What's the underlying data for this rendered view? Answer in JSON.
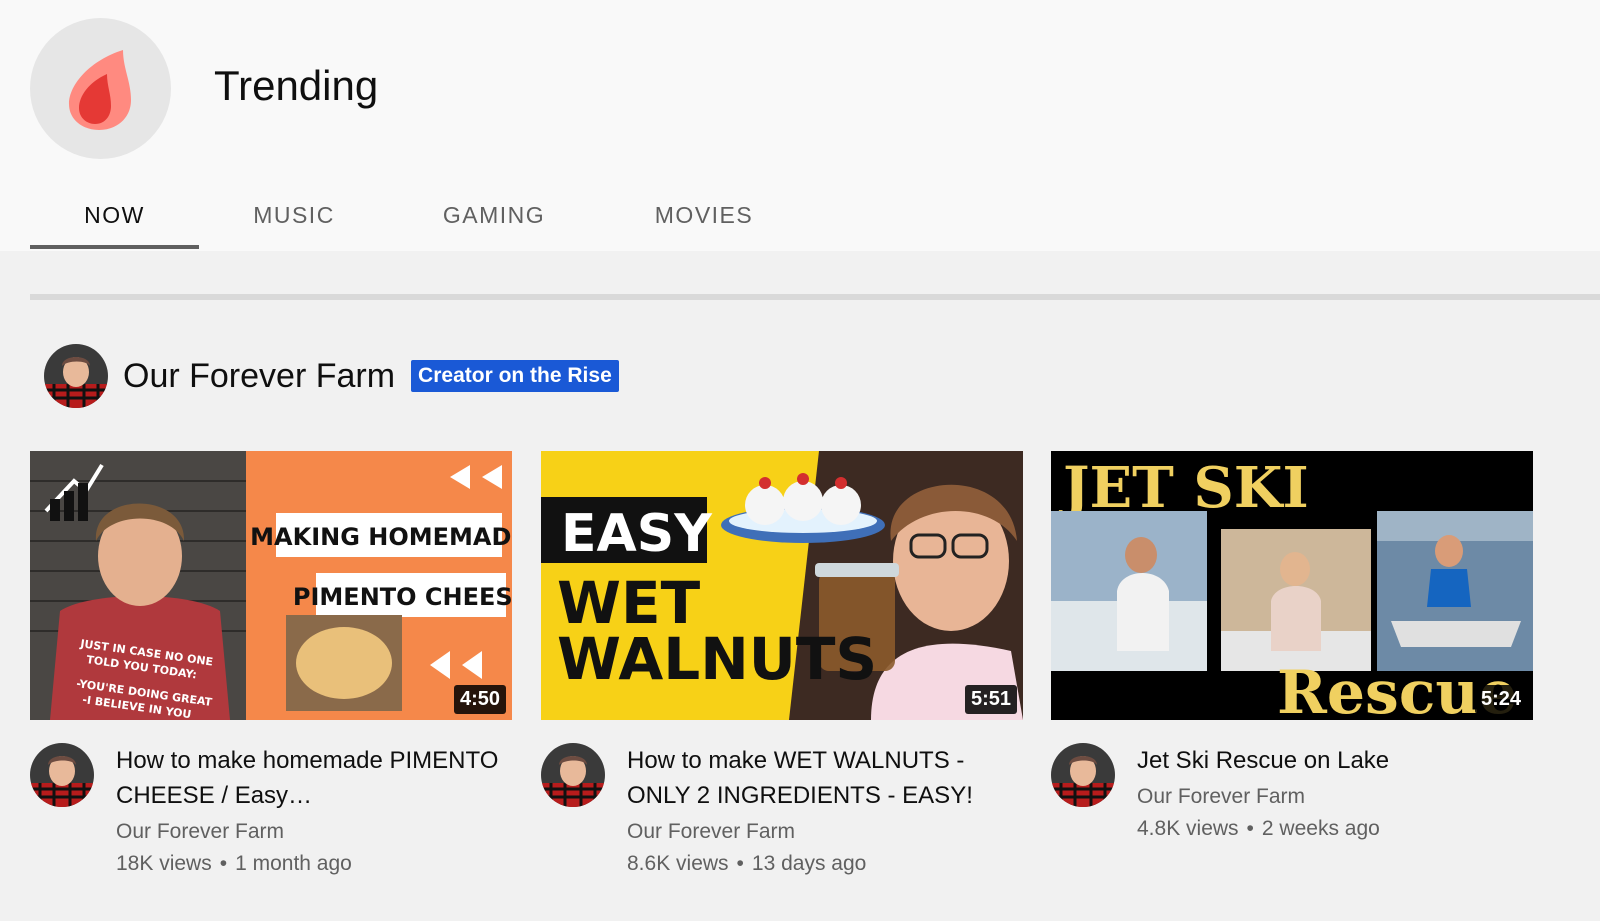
{
  "header": {
    "title": "Trending",
    "icon": "fire-icon",
    "tabs": [
      {
        "label": "NOW",
        "active": true
      },
      {
        "label": "MUSIC",
        "active": false
      },
      {
        "label": "GAMING",
        "active": false
      },
      {
        "label": "MOVIES",
        "active": false
      }
    ]
  },
  "channel": {
    "name": "Our Forever Farm",
    "badge": "Creator on the Rise"
  },
  "videos": [
    {
      "title": "How to make homemade PIMENTO CHEESE / Easy…",
      "duration": "4:50",
      "channel": "Our Forever Farm",
      "views": "18K views",
      "age": "1 month ago",
      "thumb_text": [
        "MAKING HOMEMADE",
        "PIMENTO CHEESE",
        "JUST IN CASE NO ONE",
        "TOLD YOU TODAY:",
        "-YOU'RE DOING GREAT",
        "-I BELIEVE IN YOU"
      ]
    },
    {
      "title": "How to make WET WALNUTS - ONLY 2 INGREDIENTS - EASY!",
      "duration": "5:51",
      "channel": "Our Forever Farm",
      "views": "8.6K views",
      "age": "13 days ago",
      "thumb_text": [
        "EASY",
        "WET",
        "WALNUTS"
      ]
    },
    {
      "title": "Jet Ski Rescue on Lake",
      "duration": "5:24",
      "channel": "Our Forever Farm",
      "views": "4.8K views",
      "age": "2 weeks ago",
      "thumb_text": [
        "JET SKI",
        "Rescue"
      ]
    }
  ],
  "colors": {
    "badge": "#1a59d6",
    "fire": "#f44336",
    "thumb1_orange": "#f5884a",
    "thumb2_yellow": "#f7d117",
    "thumb3_gold": "#f0d060"
  }
}
